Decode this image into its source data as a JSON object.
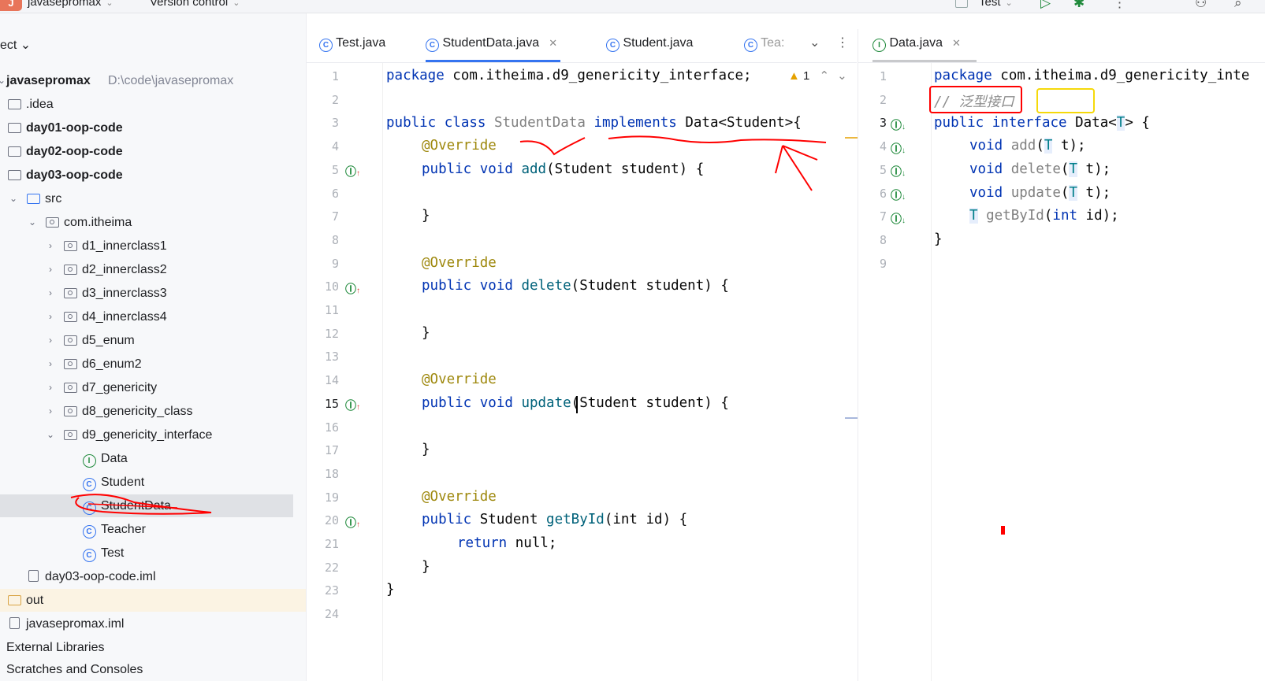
{
  "topbar": {
    "project_badge": "J",
    "project_name": "javasepromax",
    "version_control": "Version control",
    "run_config": "Test",
    "chevron": "⌄"
  },
  "sidebar": {
    "header": "ect ⌄",
    "root": {
      "name": "javasepromax",
      "path": "D:\\code\\javasepromax"
    },
    "items": [
      {
        "label": ".idea"
      },
      {
        "label": "day01-oop-code"
      },
      {
        "label": "day02-oop-code"
      },
      {
        "label": "day03-oop-code"
      },
      {
        "label": "src"
      },
      {
        "label": "com.itheima"
      },
      {
        "label": "d1_innerclass1"
      },
      {
        "label": "d2_innerclass2"
      },
      {
        "label": "d3_innerclass3"
      },
      {
        "label": "d4_innerclass4"
      },
      {
        "label": "d5_enum"
      },
      {
        "label": "d6_enum2"
      },
      {
        "label": "d7_genericity"
      },
      {
        "label": "d8_genericity_class"
      },
      {
        "label": "d9_genericity_interface"
      },
      {
        "label": "Data"
      },
      {
        "label": "Student"
      },
      {
        "label": "StudentData"
      },
      {
        "label": "Teacher"
      },
      {
        "label": "Test"
      },
      {
        "label": "day03-oop-code.iml"
      },
      {
        "label": "out"
      },
      {
        "label": "javasepromax.iml"
      },
      {
        "label": "External Libraries"
      },
      {
        "label": "Scratches and Consoles"
      }
    ]
  },
  "left_editor": {
    "tabs": [
      "Test.java",
      "StudentData.java",
      "Student.java",
      "Tea:"
    ],
    "warning_count": "1",
    "line_numbers": [
      "1",
      "2",
      "3",
      "4",
      "5",
      "6",
      "7",
      "8",
      "9",
      "10",
      "11",
      "12",
      "13",
      "14",
      "15",
      "16",
      "17",
      "18",
      "19",
      "20",
      "21",
      "22",
      "23",
      "24"
    ],
    "code": {
      "l1_kw": "package",
      "l1_rest": " com.itheima.d9_genericity_interface;",
      "l3_kw": "public class",
      "l3_cls": "StudentData",
      "l3_impl": "implements",
      "l3_rest": " Data<Student>{",
      "override": "@Override",
      "l5_kw": "public void",
      "l5_fn": "add",
      "l5_rest": "(Student student) {",
      "close_brace": "}",
      "l10_fn": "delete",
      "l10_rest": "(Student student) {",
      "l15_fn": "update",
      "l15_rest": "(Student student) {",
      "l20_kw": "public",
      "l20_type": " Student ",
      "l20_fn": "getById",
      "l20_rest": "(int id) {",
      "l21_kw": "return",
      "l21_rest": " null;"
    }
  },
  "right_editor": {
    "tab": "Data.java",
    "line_numbers": [
      "1",
      "2",
      "3",
      "4",
      "5",
      "6",
      "7",
      "8",
      "9"
    ],
    "code": {
      "l1_kw": "package",
      "l1_rest": " com.itheima.d9_genericity_inte",
      "l2_comment": "// 泛型接口",
      "l3_kw": "public interface",
      "l3_name": " Data<",
      "l3_t": "T",
      "l3_rest": "> {",
      "void": "void",
      "add": "add",
      "delete": "delete",
      "update": "update",
      "t_param": "T",
      "t_rest": " t);",
      "getbyid": "getById",
      "int": "int",
      "id_rest": " id);",
      "close": "}"
    }
  },
  "colors": {
    "accent": "#3574f0",
    "keyword": "#0033b3",
    "annotation": "#9e880d",
    "method": "#00627a",
    "interface_icon": "#208a3c",
    "annotation_pen": "#ff0000",
    "highlight_box": "#f5d90a"
  }
}
